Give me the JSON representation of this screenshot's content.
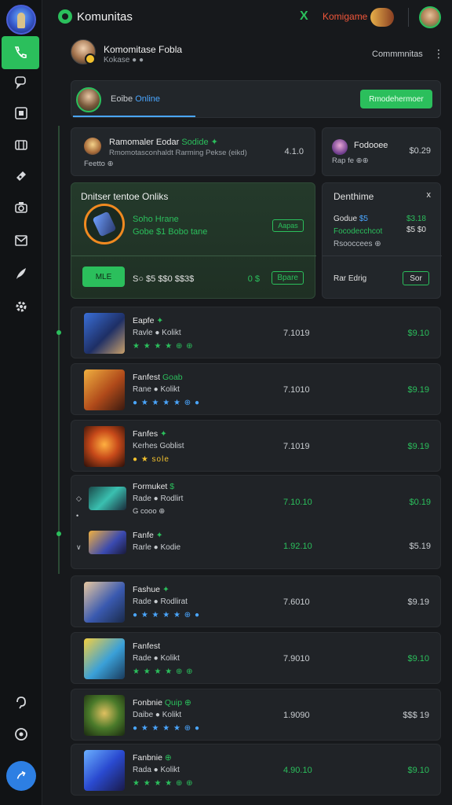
{
  "header": {
    "brand": "Komunitas",
    "promo": "Komigame",
    "x_label": "X"
  },
  "rail": {
    "items": [
      "phone-icon",
      "chat-icon",
      "library-icon",
      "store-icon",
      "ticket-icon",
      "camera-icon",
      "mail-icon",
      "feather-icon",
      "gear-icon",
      "help-icon",
      "refresh-icon"
    ],
    "fab_icon": "compose-icon"
  },
  "profile": {
    "name": "Komomitase Fobla",
    "sub": "Kokase ● ●",
    "community": "Commmnitas",
    "menu": "⋮"
  },
  "online": {
    "label_prefix": "Eoibe",
    "label_status": "Online",
    "button": "Rmodehermoer"
  },
  "feature": {
    "title_prefix": "Ramomaler Eodar",
    "title_highlight": "Sodide ✦",
    "desc": "Rmomotasconhaldt Rarming Pekse (eikd)",
    "meta": "Feetto ⊕",
    "num": "4.1.0"
  },
  "side_top": {
    "title": "Fodooee",
    "num": "$0.29",
    "meta": "Rap fe ⊕⊕"
  },
  "promo_panel": {
    "title": "Dnitser tentoe Onliks",
    "line1": "Soho Hrane",
    "line2": "Gobe $1 Bobo tane",
    "tag": "Aapas",
    "button": "MLE",
    "price_line": "S○ $5 $$0 $$3$",
    "right_prefix": "0 $",
    "right_link": "Bpare"
  },
  "side_mid": {
    "title": "Denthime",
    "close": "x",
    "l1_prefix": "Godue",
    "l1_highlight": "$5",
    "l2": "Focodecchcot",
    "l3": "Rsooccees ⊕",
    "r1": "$3.18",
    "r2": "$5 $0",
    "label": "Rar Edrig",
    "button": "Sor"
  },
  "rows": [
    {
      "t1": "Eapfe",
      "t1_hl": "✦",
      "t2": "Ravle ● Kolikt",
      "stars": "★ ★ ★ ★ ⊕ ⊕",
      "num": "7.1019",
      "num_green": false,
      "price": "$9.10",
      "price_green": true
    },
    {
      "t1": "Fanfest",
      "t1_hl": "Goab",
      "t2": "Rane ● Kolikt",
      "stars": "● ★ ★ ★ ★ ⊕ ●",
      "num": "7.1010",
      "num_green": false,
      "price": "$9.19",
      "price_green": true
    },
    {
      "t1": "Fanfes",
      "t1_hl": "✦",
      "t2": "Kerhes Goblist",
      "stars": "● ★ sole",
      "num": "7.1019",
      "num_green": false,
      "price": "$9.19",
      "price_green": true
    },
    {
      "t1": "Fashue",
      "t1_hl": "✦",
      "t2": "Rade ● Rodlirat",
      "stars": "● ★ ★ ★ ★ ⊕ ●",
      "num": "7.6010",
      "num_green": false,
      "price": "$9.19",
      "price_green": false
    },
    {
      "t1": "Fanfest",
      "t1_hl": "",
      "t2": "Rade ● Kolikt",
      "stars": "★ ★ ★ ★ ⊕ ⊕",
      "num": "7.9010",
      "num_green": false,
      "price": "$9.10",
      "price_green": true
    },
    {
      "t1": "Fonbnie",
      "t1_hl": "Quip ⊕",
      "t2": "Daibe ● Kolikt",
      "stars": "● ★ ★ ★ ★ ⊕ ●",
      "num": "1.9090",
      "num_green": false,
      "price": "$$$ 19",
      "price_green": false
    },
    {
      "t1": "Fanbnie",
      "t1_hl": "⊕",
      "t2": "Rada ● Kolikt",
      "stars": "★ ★ ★ ★ ⊕ ⊕",
      "num": "4.90.10",
      "num_green": true,
      "price": "$9.10",
      "price_green": true
    }
  ],
  "group": {
    "a": {
      "t1": "Formuket",
      "t1_hl": "$",
      "t2": "Rade ● Rodlirt",
      "t3": "G cooo ⊕",
      "num": "7.10.10",
      "price": "$0.19"
    },
    "b": {
      "t1": "Fanfe",
      "t1_hl": "✦",
      "t2": "Rarle ● Kodie",
      "num": "1.92.10",
      "price": "$5.19"
    }
  },
  "colors": {
    "accent": "#2bbf5c",
    "link": "#4aa6ff",
    "promo": "#f0563a",
    "background": "#17191c"
  }
}
